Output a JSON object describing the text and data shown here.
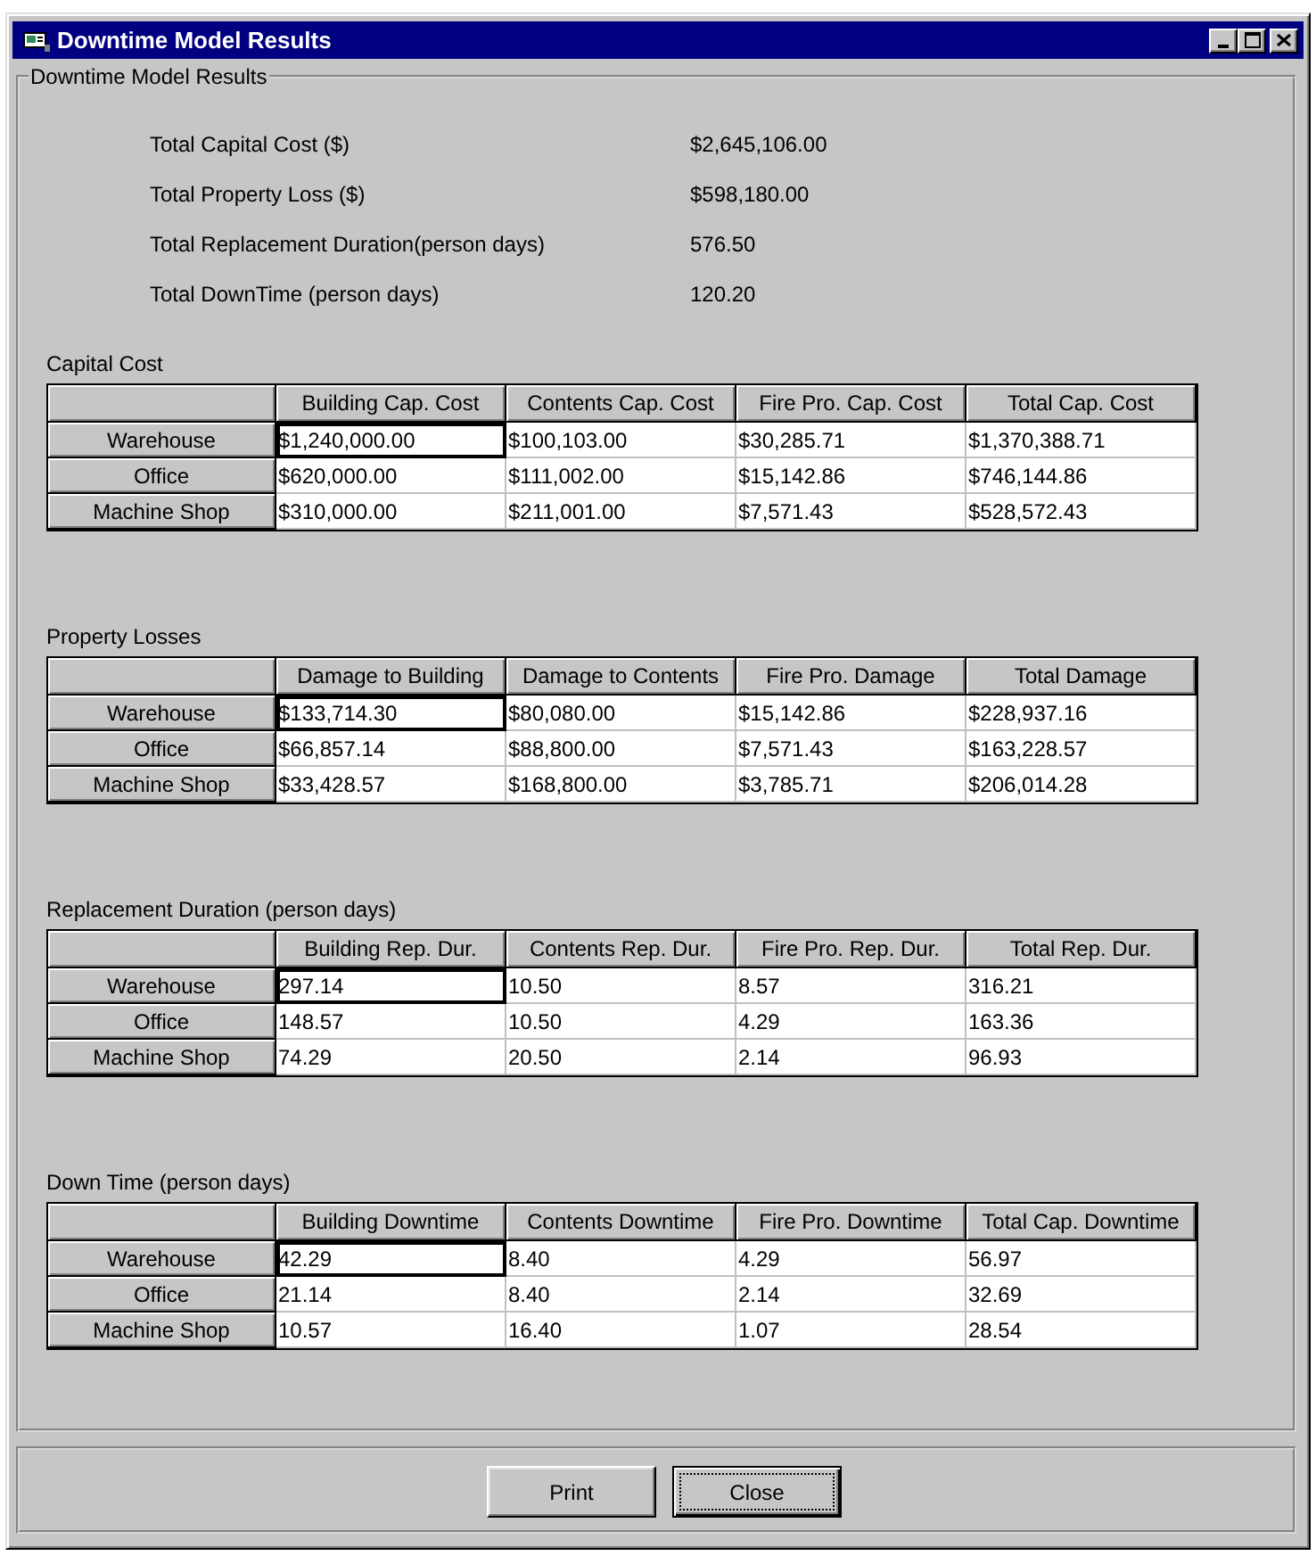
{
  "window": {
    "title": "Downtime Model Results"
  },
  "group": {
    "title": "Downtime Model Results"
  },
  "summary": [
    {
      "label": "Total Capital Cost ($)",
      "value": "$2,645,106.00"
    },
    {
      "label": "Total Property Loss ($)",
      "value": "$598,180.00"
    },
    {
      "label": "Total Replacement Duration(person days)",
      "value": "576.50"
    },
    {
      "label": "Total DownTime (person days)",
      "value": "120.20"
    }
  ],
  "tables": [
    {
      "title": "Capital Cost",
      "columns": [
        "Building Cap. Cost",
        "Contents Cap. Cost",
        "Fire Pro. Cap. Cost",
        "Total Cap. Cost"
      ],
      "rows": [
        {
          "label": "Warehouse",
          "cells": [
            {
              "value": "$1,240,000.00",
              "focused": true
            },
            {
              "value": "$100,103.00",
              "focused": false
            },
            {
              "value": "$30,285.71",
              "focused": false
            },
            {
              "value": "$1,370,388.71",
              "focused": false
            }
          ]
        },
        {
          "label": "Office",
          "cells": [
            {
              "value": "$620,000.00",
              "focused": false
            },
            {
              "value": "$111,002.00",
              "focused": false
            },
            {
              "value": "$15,142.86",
              "focused": false
            },
            {
              "value": "$746,144.86",
              "focused": false
            }
          ]
        },
        {
          "label": "Machine Shop",
          "cells": [
            {
              "value": "$310,000.00",
              "focused": false
            },
            {
              "value": "$211,001.00",
              "focused": false
            },
            {
              "value": "$7,571.43",
              "focused": false
            },
            {
              "value": "$528,572.43",
              "focused": false
            }
          ]
        }
      ]
    },
    {
      "title": "Property Losses",
      "columns": [
        "Damage to Building",
        "Damage to Contents",
        "Fire Pro. Damage",
        "Total Damage"
      ],
      "rows": [
        {
          "label": "Warehouse",
          "cells": [
            {
              "value": "$133,714.30",
              "focused": true
            },
            {
              "value": "$80,080.00",
              "focused": false
            },
            {
              "value": "$15,142.86",
              "focused": false
            },
            {
              "value": "$228,937.16",
              "focused": false
            }
          ]
        },
        {
          "label": "Office",
          "cells": [
            {
              "value": "$66,857.14",
              "focused": false
            },
            {
              "value": "$88,800.00",
              "focused": false
            },
            {
              "value": "$7,571.43",
              "focused": false
            },
            {
              "value": "$163,228.57",
              "focused": false
            }
          ]
        },
        {
          "label": "Machine Shop",
          "cells": [
            {
              "value": "$33,428.57",
              "focused": false
            },
            {
              "value": "$168,800.00",
              "focused": false
            },
            {
              "value": "$3,785.71",
              "focused": false
            },
            {
              "value": "$206,014.28",
              "focused": false
            }
          ]
        }
      ]
    },
    {
      "title": "Replacement Duration (person days)",
      "columns": [
        "Building Rep. Dur.",
        "Contents Rep. Dur.",
        "Fire Pro. Rep. Dur.",
        "Total Rep. Dur."
      ],
      "rows": [
        {
          "label": "Warehouse",
          "cells": [
            {
              "value": "297.14",
              "focused": true
            },
            {
              "value": "10.50",
              "focused": false
            },
            {
              "value": "8.57",
              "focused": false
            },
            {
              "value": "316.21",
              "focused": false
            }
          ]
        },
        {
          "label": "Office",
          "cells": [
            {
              "value": "148.57",
              "focused": false
            },
            {
              "value": "10.50",
              "focused": false
            },
            {
              "value": "4.29",
              "focused": false
            },
            {
              "value": "163.36",
              "focused": false
            }
          ]
        },
        {
          "label": "Machine Shop",
          "cells": [
            {
              "value": "74.29",
              "focused": false
            },
            {
              "value": "20.50",
              "focused": false
            },
            {
              "value": "2.14",
              "focused": false
            },
            {
              "value": "96.93",
              "focused": false
            }
          ]
        }
      ]
    },
    {
      "title": "Down Time (person days)",
      "columns": [
        "Building Downtime",
        "Contents Downtime",
        "Fire Pro. Downtime",
        "Total Cap. Downtime"
      ],
      "rows": [
        {
          "label": "Warehouse",
          "cells": [
            {
              "value": "42.29",
              "focused": true
            },
            {
              "value": "8.40",
              "focused": false
            },
            {
              "value": "4.29",
              "focused": false
            },
            {
              "value": "56.97",
              "focused": false
            }
          ]
        },
        {
          "label": "Office",
          "cells": [
            {
              "value": "21.14",
              "focused": false
            },
            {
              "value": "8.40",
              "focused": false
            },
            {
              "value": "2.14",
              "focused": false
            },
            {
              "value": "32.69",
              "focused": false
            }
          ]
        },
        {
          "label": "Machine Shop",
          "cells": [
            {
              "value": "10.57",
              "focused": false
            },
            {
              "value": "16.40",
              "focused": false
            },
            {
              "value": "1.07",
              "focused": false
            },
            {
              "value": "28.54",
              "focused": false
            }
          ]
        }
      ]
    }
  ],
  "buttons": [
    {
      "label": "Print",
      "focused": false
    },
    {
      "label": "Close",
      "focused": true
    }
  ]
}
